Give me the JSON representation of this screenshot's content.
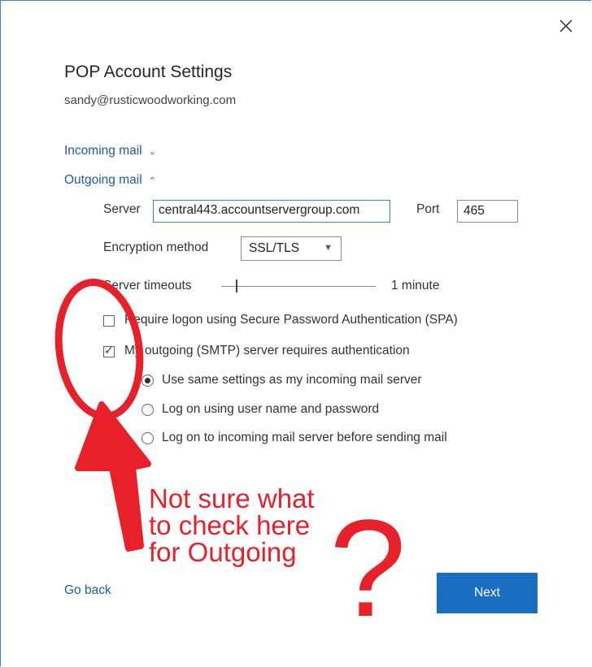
{
  "dialog": {
    "title": "POP Account Settings",
    "email": "sandy@rusticwoodworking.com"
  },
  "incoming": {
    "label": "Incoming mail",
    "chevron": "chevron-down-icon"
  },
  "outgoing": {
    "label": "Outgoing mail",
    "chevron": "chevron-up-icon",
    "server_label": "Server",
    "server_value": "central443.accountservergroup.com",
    "port_label": "Port",
    "port_value": "465",
    "encryption_label": "Encryption method",
    "encryption_value": "SSL/TLS",
    "timeout_label": "Server timeouts",
    "timeout_value": "1 minute",
    "spa_label": "Require logon using Secure Password Authentication (SPA)",
    "spa_checked": false,
    "auth_label": "My outgoing (SMTP) server requires authentication",
    "auth_checked": true,
    "radio_options": [
      {
        "label": "Use same settings as my incoming mail server",
        "selected": true
      },
      {
        "label": "Log on using user name and password",
        "selected": false
      },
      {
        "label": "Log on to incoming mail server before sending mail",
        "selected": false
      }
    ]
  },
  "footer": {
    "go_back": "Go back",
    "next": "Next"
  },
  "annotation": {
    "lines": [
      "Not sure what",
      "to check here",
      "for Outgoing"
    ],
    "question_mark": "?",
    "color": "#e8202a"
  },
  "colors": {
    "accent": "#1a6ec1",
    "link": "#1e5aa0",
    "annotation": "#e8202a"
  }
}
